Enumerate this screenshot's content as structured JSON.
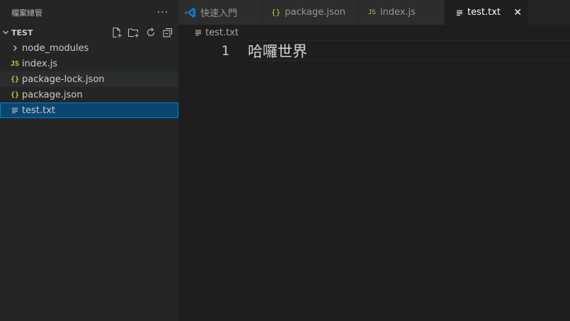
{
  "sidebar": {
    "title": "檔案總管",
    "more_label": "···",
    "section": {
      "name": "TEST"
    },
    "items": [
      {
        "label": "node_modules",
        "icon": "chevron-right-icon"
      },
      {
        "label": "index.js",
        "icon": "js-file-icon",
        "badge": "JS"
      },
      {
        "label": "package-lock.json",
        "icon": "json-file-icon",
        "badge": "{}"
      },
      {
        "label": "package.json",
        "icon": "json-file-icon",
        "badge": "{}"
      },
      {
        "label": "test.txt",
        "icon": "text-file-icon"
      }
    ]
  },
  "tabs": [
    {
      "label": "快速入門",
      "icon": "vscode-logo-icon"
    },
    {
      "label": "package.json",
      "icon": "json-file-icon",
      "badge": "{}"
    },
    {
      "label": "index.js",
      "icon": "js-file-icon",
      "badge": "JS"
    },
    {
      "label": "test.txt",
      "icon": "text-file-icon",
      "active": true,
      "close": "✕"
    }
  ],
  "breadcrumb": {
    "label": "test.txt"
  },
  "editor": {
    "lines": [
      {
        "number": "1",
        "text": "哈囉世界"
      }
    ]
  },
  "colors": {
    "selection": "#094771",
    "selection_border": "#007fd4",
    "icon_yellow": "#cbcb41",
    "vscode_blue": "#0a7bcc"
  }
}
